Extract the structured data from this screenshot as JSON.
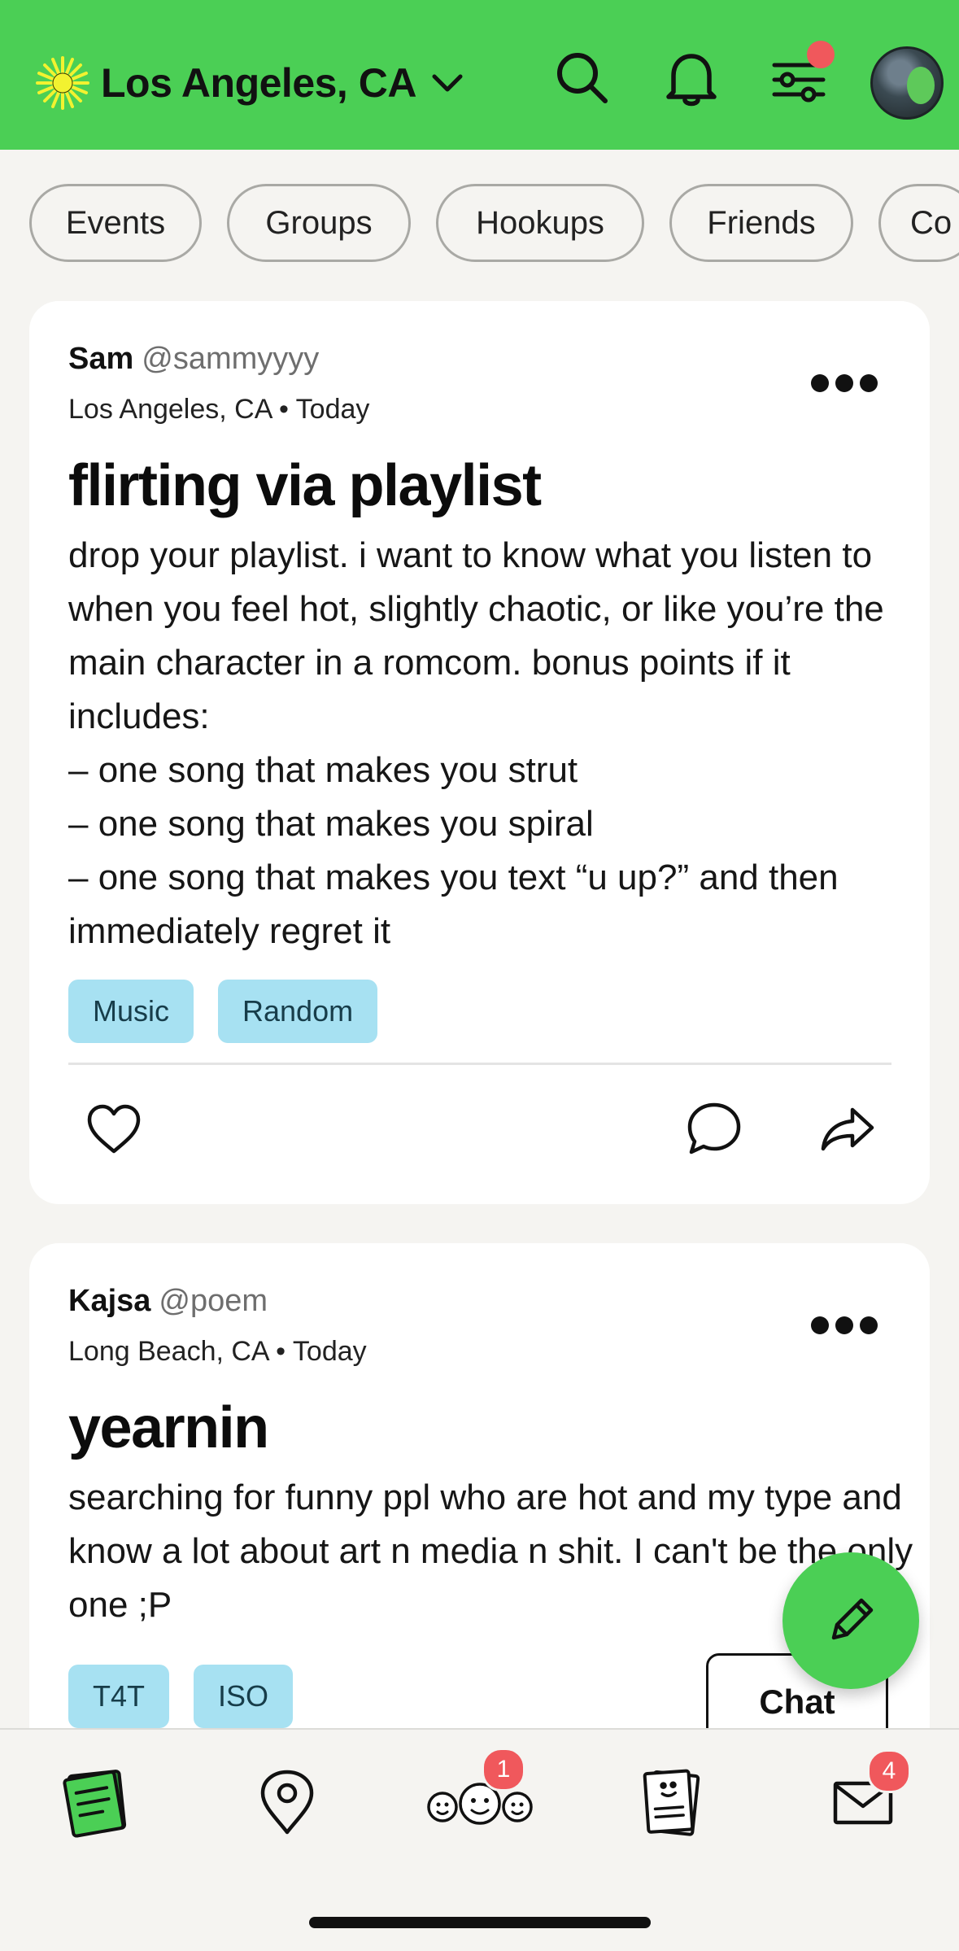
{
  "header": {
    "location": "Los Angeles, CA",
    "icons": [
      "sun-icon",
      "chevron-down-icon",
      "search-icon",
      "bell-icon",
      "filter-sliders-icon",
      "avatar"
    ],
    "accent": "#4bcf55",
    "notification_dot_color": "#f0585c"
  },
  "filters": [
    "Events",
    "Groups",
    "Hookups",
    "Friends",
    "Co"
  ],
  "posts": [
    {
      "name": "Sam",
      "handle": "@sammyyyy",
      "meta": "Los Angeles, CA • Today",
      "title": "flirting via playlist",
      "body": "drop your playlist. i want to know what you listen to when you feel hot, slightly chaotic, or like you’re the main character in a romcom. bonus points if it includes:\n– one song that makes you strut\n– one song that makes you spiral\n– one song that makes you text “u up?” and then immediately regret it",
      "tags": [
        "Music",
        "Random"
      ]
    },
    {
      "name": "Kajsa",
      "handle": "@poem",
      "meta": "Long Beach, CA • Today",
      "title": "yearnin",
      "body": "searching for funny ppl who are hot and my type and  know a lot about art n media n shit. I can't be the only one ;P",
      "tags": [
        "T4T",
        "ISO"
      ],
      "chat_label": "Chat"
    }
  ],
  "tab_bar": {
    "items": [
      "feed-icon",
      "map-pin-icon",
      "people-icon",
      "profiles-icon",
      "mail-icon"
    ],
    "people_badge": "1",
    "mail_badge": "4"
  }
}
